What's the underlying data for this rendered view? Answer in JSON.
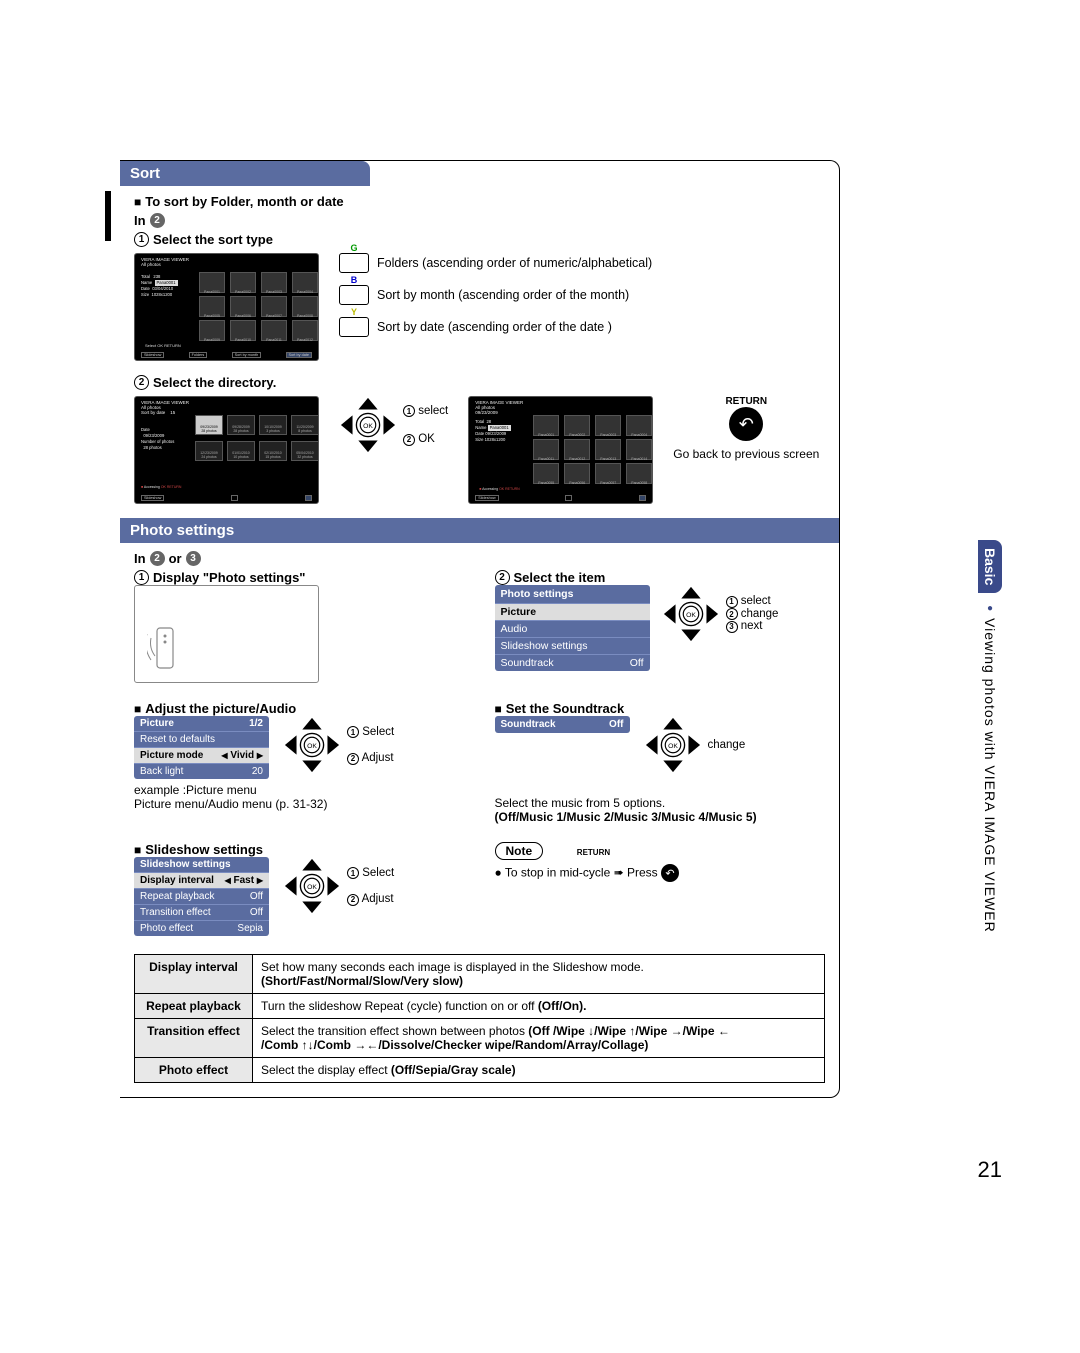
{
  "page_number": "21",
  "side": {
    "basic": "Basic",
    "label": "Viewing photos with VIERA IMAGE VIEWER"
  },
  "sort": {
    "title": "Sort",
    "heading": "To sort by Folder, month or date",
    "in": "In",
    "step1": "Select the sort type",
    "keys": {
      "g_letter": "G",
      "g_label": "Folders (ascending order of numeric/alphabetical)",
      "b_letter": "B",
      "b_label": "Sort by month (ascending order of the month)",
      "y_letter": "Y",
      "y_label": "Sort by date (ascending order of the date )"
    },
    "tv1": {
      "hdr1": "VIERA IMAGE VIEWER",
      "hdr2": "All photos",
      "total_l": "Total",
      "total_v": "238",
      "name_l": "Name",
      "name_v": "Pana0001",
      "date_l": "Date",
      "date_v": "03/04/2010",
      "size_l": "Size",
      "size_v": "1028x1200",
      "thumbs": [
        "Pana0001",
        "Pana0002",
        "Pana0003",
        "Pana0004",
        "Pana0005",
        "Pana0006",
        "Pana0007",
        "Pana0008",
        "Pana0009",
        "Pana0010",
        "Pana0011",
        "Pana0012"
      ],
      "sel": "Select",
      "ret": "RETURN",
      "b_slideshow": "Slideshow",
      "b_folders": "Folders",
      "b_sortmonth": "Sort by month",
      "b_sortdate": "Sort by date"
    },
    "step2": "Select the directory.",
    "nav_select": "select",
    "nav_ok": "OK",
    "tv2": {
      "hdr1": "VIERA IMAGE VIEWER",
      "hdr2": "All photos",
      "hdr3": "Sort by date",
      "count": "15",
      "date_l": "Date",
      "date_v": "09/23/2009",
      "np_l": "Number of photos",
      "np_v": "28 photos",
      "cells": [
        [
          "09/23/2009",
          "28 photos"
        ],
        [
          "09/28/2009",
          "28 photos"
        ],
        [
          "10/10/2009",
          "3 photos"
        ],
        [
          "11/20/2009",
          "8 photos"
        ],
        [
          "12/23/2009",
          "24 photos"
        ],
        [
          "01/01/2010",
          "10 photos"
        ],
        [
          "02/10/2010",
          "15 photos"
        ],
        [
          "05/04/2010",
          "32 photos"
        ]
      ],
      "acc": "Accessing",
      "b_slideshow": "Slideshow"
    },
    "tv3": {
      "hdr1": "VIERA IMAGE VIEWER",
      "hdr2": "All photos",
      "hdr3": "09/23/2009",
      "total_l": "Total",
      "total_v": "28",
      "name_l": "Name",
      "name_v": "Pana0001",
      "date_l": "Date",
      "date_v": "09/23/2009",
      "size_l": "Size",
      "size_v": "1028x1200",
      "thumbs": [
        "Pana0001",
        "Pana0002",
        "Pana0003",
        "Pana0004",
        "Pana0011",
        "Pana0012",
        "Pana0013",
        "Pana0014",
        "Pana0055",
        "Pana0056",
        "Pana0057",
        "Pana0058"
      ],
      "acc": "Accessing",
      "ok": "OK",
      "ret": "RETURN",
      "b_slideshow": "Slideshow"
    },
    "return_label": "RETURN",
    "return_text": "Go back to previous screen"
  },
  "photo": {
    "title": "Photo settings",
    "in": "In",
    "or": "or",
    "step1": "Display \"Photo settings\"",
    "step2": "Select the item",
    "menu": {
      "title": "Photo settings",
      "items": [
        "Picture",
        "Audio",
        "Slideshow settings"
      ],
      "sound_l": "Soundtrack",
      "sound_v": "Off"
    },
    "nav1": "select",
    "nav2": "change",
    "nav3": "next",
    "adjust_head": "Adjust the picture/Audio",
    "pic_menu": {
      "title": "Picture",
      "page": "1/2",
      "reset": "Reset to defaults",
      "mode_l": "Picture mode",
      "mode_v": "Vivid",
      "back_l": "Back light",
      "back_v": "20"
    },
    "pic_nav1": "Select",
    "pic_nav2": "Adjust",
    "example1": "example :Picture menu",
    "example2": "Picture menu/Audio menu (p. 31-32)",
    "sound_head": "Set the Soundtrack",
    "sound_menu": {
      "l": "Soundtrack",
      "v": "Off"
    },
    "sound_change": "change",
    "sound_select": "Select the music from 5 options.",
    "sound_opts": "(Off/Music 1/Music 2/Music 3/Music 4/Music 5)",
    "slide_head": "Slideshow settings",
    "slide_menu": {
      "title": "Slideshow settings",
      "di_l": "Display interval",
      "di_v": "Fast",
      "rp_l": "Repeat playback",
      "rp_v": "Off",
      "te_l": "Transition effect",
      "te_v": "Off",
      "pe_l": "Photo effect",
      "pe_v": "Sepia"
    },
    "slide_nav1": "Select",
    "slide_nav2": "Adjust",
    "note_label": "Note",
    "note_text": "To stop in mid-cycle ➠ Press",
    "note_return": "RETURN"
  },
  "table": {
    "rows": [
      {
        "k": "Display interval",
        "v1": "Set how many seconds each image is displayed in the Slideshow mode.",
        "v2": "(Short/Fast/Normal/Slow/Very slow)"
      },
      {
        "k": "Repeat playback",
        "v": "Turn the slideshow Repeat (cycle) function on or off (Off/On)."
      },
      {
        "k": "Transition effect",
        "v1": "Select the transition effect shown between photos (Off /Wipe ↓/Wipe ↑/Wipe →/Wipe ←",
        "v2": "/Comb ↑↓/Comb →←/Dissolve/Checker wipe/Random/Array/Collage)"
      },
      {
        "k": "Photo effect",
        "v": "Select the display effect (Off/Sepia/Gray scale)"
      }
    ]
  }
}
